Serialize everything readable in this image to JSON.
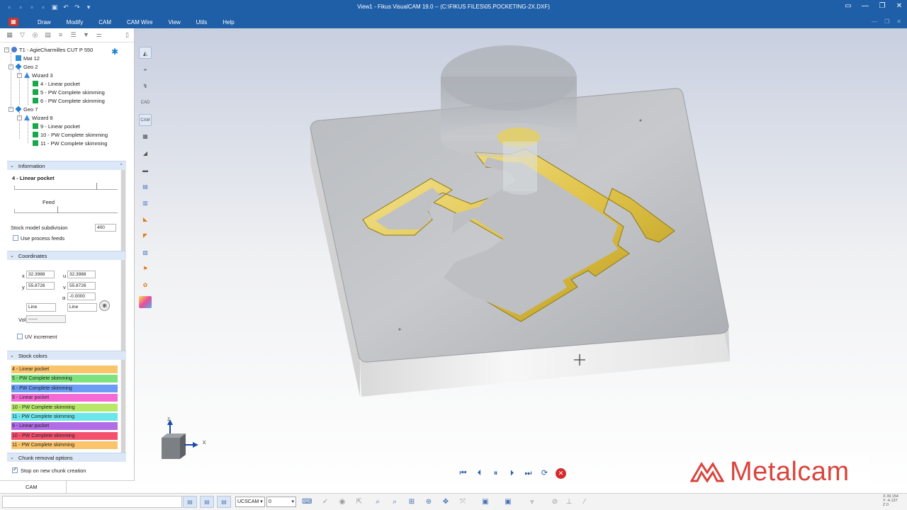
{
  "window": {
    "title": "View1 - Fikus VisualCAM 19.0 -- (C:\\FIKUS FILES\\05.POCKETING-2X.DXF)"
  },
  "menu": [
    "Draw",
    "Modify",
    "CAM",
    "CAM Wire",
    "View",
    "Utils",
    "Help"
  ],
  "tree": {
    "tool": "T1 - AgieCharmilles CUT P 550",
    "mat": "Mat 12",
    "geo1": "Geo 2",
    "wizard1": "Wizard 3",
    "op1": "4 - Linear pocket",
    "op2": "5 - PW Complete skimming",
    "op3": "6 - PW Complete skimming",
    "geo2": "Geo 7",
    "wizard2": "Wizard 8",
    "op4": "9 - Linear pocket",
    "op5": "10 - PW Complete skimming",
    "op6": "11 - PW Complete skimming"
  },
  "information": {
    "header": "Information",
    "operation": "4 - Linear pocket",
    "feed_label": "Feed",
    "stock_label": "Stock model subdivision",
    "stock_value": "400",
    "use_process_feeds": "Use process feeds"
  },
  "coordinates": {
    "header": "Coordinates",
    "x_label": "x",
    "x_value": "32.3988",
    "u_label": "u",
    "u_value": "32.3988",
    "y_label": "y",
    "y_value": "55.8726",
    "v_label": "v",
    "v_value": "55.8726",
    "alpha_label": "α",
    "alpha_value": "-0.0000",
    "line1": "Line",
    "line2": "Line",
    "vol_label": "Vol",
    "vol_value": "------",
    "uv_increment": "UV increment"
  },
  "stock_colors": {
    "header": "Stock colors",
    "items": [
      {
        "label": "4 - Linear pocket",
        "color": "#f9c46a"
      },
      {
        "label": "5 - PW Complete skimming",
        "color": "#7ee37e"
      },
      {
        "label": "6 - PW Complete skimming",
        "color": "#6c9cf5"
      },
      {
        "label": "9 - Linear pocket",
        "color": "#f56bd6"
      },
      {
        "label": "10 - PW Complete skimming",
        "color": "#b8e86a"
      },
      {
        "label": "11 - PW Complete skimming",
        "color": "#6be7ec"
      },
      {
        "label": "9 - Linear pocket",
        "color": "#b26ce6"
      },
      {
        "label": "10 - PW Complete skimming",
        "color": "#f4516e"
      },
      {
        "label": "11 - PW Complete skimming",
        "color": "#f9c46a"
      }
    ]
  },
  "chunk": {
    "header": "Chunk removal options",
    "stop_label": "Stop on new chunk creation"
  },
  "bottom_tab": "CAM",
  "axes": {
    "z": "z",
    "x": "x"
  },
  "logo": "Metalcam",
  "statusbar": {
    "ucs": "UCSCAM",
    "ucs_value": "0",
    "coords": [
      "X 39.154",
      "Y -4.137",
      "Z 0"
    ]
  }
}
